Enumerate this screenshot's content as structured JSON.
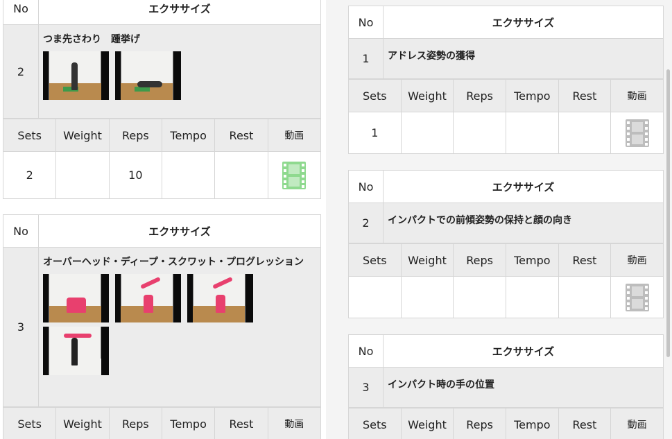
{
  "left": {
    "cards": [
      {
        "header_no": "No",
        "header_exercise": "エクササイズ",
        "number": "2",
        "name": "つま先さわり　踵挙げ",
        "thumbnails": [
          "standing",
          "bent-forward"
        ],
        "set_headers": [
          "Sets",
          "Weight",
          "Reps",
          "Tempo",
          "Rest",
          "動画"
        ],
        "values": {
          "sets": "2",
          "weight": "",
          "reps": "10",
          "tempo": "",
          "rest": ""
        },
        "video_icon_color": "#8fd98f"
      },
      {
        "header_no": "No",
        "header_exercise": "エクササイズ",
        "number": "3",
        "name": "オーバーヘッド・ディープ・スクワット・プログレッション",
        "thumbnails": [
          "squat-1",
          "squat-2",
          "squat-3",
          "overhead"
        ],
        "set_headers": [
          "Sets",
          "Weight",
          "Reps",
          "Tempo",
          "Rest",
          "動画"
        ]
      }
    ]
  },
  "right": {
    "cards": [
      {
        "header_no": "No",
        "header_exercise": "エクササイズ",
        "number": "1",
        "name": "アドレス姿勢の獲得",
        "set_headers": [
          "Sets",
          "Weight",
          "Reps",
          "Tempo",
          "Rest",
          "動画"
        ],
        "values": {
          "sets": "1",
          "weight": "",
          "reps": "",
          "tempo": "",
          "rest": ""
        },
        "video_icon_color": "#bdbdbd"
      },
      {
        "header_no": "No",
        "header_exercise": "エクササイズ",
        "number": "2",
        "name": "インパクトでの前傾姿勢の保持と顔の向き",
        "set_headers": [
          "Sets",
          "Weight",
          "Reps",
          "Tempo",
          "Rest",
          "動画"
        ],
        "values": {
          "sets": "",
          "weight": "",
          "reps": "",
          "tempo": "",
          "rest": ""
        },
        "video_icon_color": "#bdbdbd"
      },
      {
        "header_no": "No",
        "header_exercise": "エクササイズ",
        "number": "3",
        "name": "インパクト時の手の位置",
        "set_headers": [
          "Sets",
          "Weight",
          "Reps",
          "Tempo",
          "Rest",
          "動画"
        ]
      }
    ]
  }
}
